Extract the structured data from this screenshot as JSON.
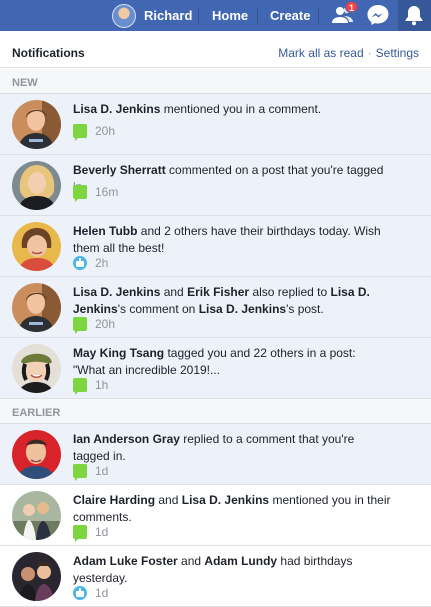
{
  "topbar": {
    "user_name": "Richard",
    "home_label": "Home",
    "create_label": "Create",
    "friend_requests_count": "1",
    "accent_color": "#4267b2"
  },
  "panel": {
    "title": "Notifications",
    "mark_all_read": "Mark all as read",
    "separator": "·",
    "settings": "Settings"
  },
  "sections": {
    "new": "NEW",
    "earlier": "EARLIER"
  },
  "notifications": [
    {
      "parts": [
        {
          "b": "Lisa D. Jenkins"
        },
        {
          "t": " mentioned you in a comment."
        }
      ],
      "time": "20h",
      "icon": "comment-icon",
      "unread": true
    },
    {
      "parts": [
        {
          "b": "Beverly Sherratt"
        },
        {
          "t": " commented on a post that you're tagged in."
        }
      ],
      "time": "16m",
      "icon": "comment-icon",
      "unread": true
    },
    {
      "parts": [
        {
          "b": "Helen Tubb"
        },
        {
          "t": " and 2 others have their birthdays today. Wish them all the best!"
        }
      ],
      "time": "2h",
      "icon": "birthday-cake-icon",
      "unread": true
    },
    {
      "parts": [
        {
          "b": "Lisa D. Jenkins"
        },
        {
          "t": " and "
        },
        {
          "b": "Erik Fisher"
        },
        {
          "t": " also replied to "
        },
        {
          "b": "Lisa D. Jenkins"
        },
        {
          "t": "'s comment on "
        },
        {
          "b": "Lisa D. Jenkins"
        },
        {
          "t": "'s post."
        }
      ],
      "time": "20h",
      "icon": "comment-icon",
      "unread": true
    },
    {
      "parts": [
        {
          "b": "May King Tsang"
        },
        {
          "t": " tagged you and 22 others in a post: \"What an incredible 2019!..."
        }
      ],
      "time": "1h",
      "icon": "comment-icon",
      "unread": true
    },
    {
      "parts": [
        {
          "b": "Ian Anderson Gray"
        },
        {
          "t": " replied to a comment that you're tagged in."
        }
      ],
      "time": "1d",
      "icon": "comment-icon",
      "unread": true
    },
    {
      "parts": [
        {
          "b": "Claire Harding"
        },
        {
          "t": " and "
        },
        {
          "b": "Lisa D. Jenkins"
        },
        {
          "t": " mentioned you in their comments."
        }
      ],
      "time": "1d",
      "icon": "comment-icon",
      "unread": false
    },
    {
      "parts": [
        {
          "b": "Adam Luke Foster"
        },
        {
          "t": " and "
        },
        {
          "b": "Adam Lundy"
        },
        {
          "t": " had birthdays yesterday."
        }
      ],
      "time": "1d",
      "icon": "birthday-cake-icon",
      "unread": false
    }
  ]
}
